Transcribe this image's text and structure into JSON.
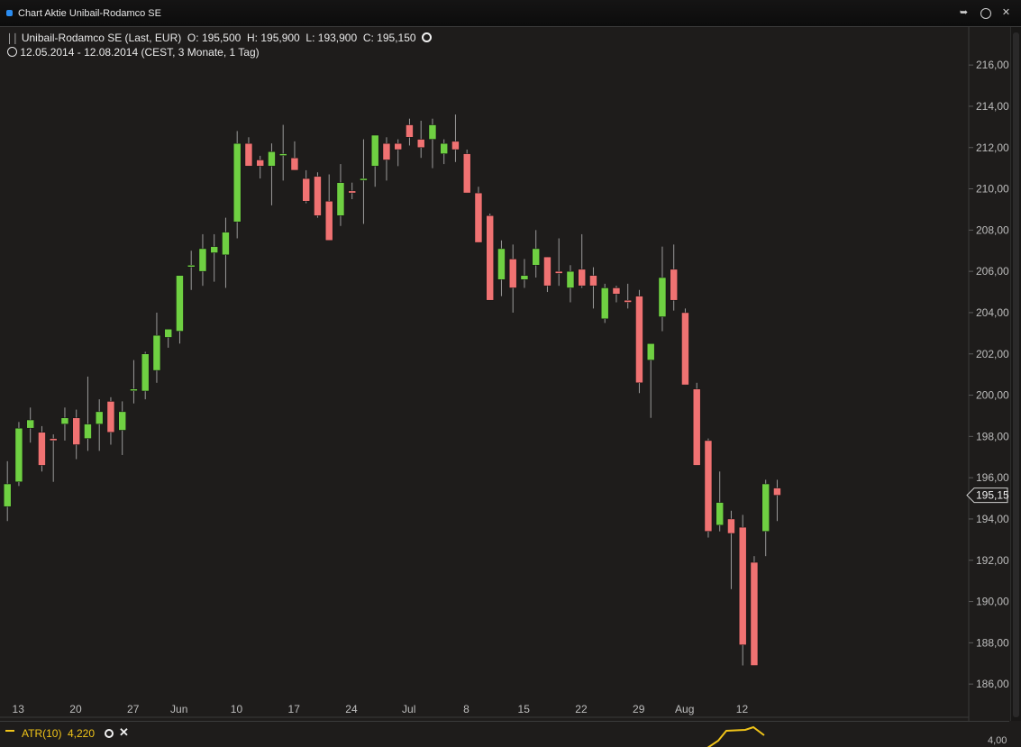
{
  "window": {
    "title": "Chart Aktie Unibail-Rodamco SE"
  },
  "header": {
    "instrument": "Unibail-Rodamco SE (Last, EUR)",
    "open_label": "O:",
    "open": "195,500",
    "high_label": "H:",
    "high": "195,900",
    "low_label": "L:",
    "low": "193,900",
    "close_label": "C:",
    "close": "195,150",
    "range": "12.05.2014 - 12.08.2014 (CEST, 3 Monate, 1 Tag)"
  },
  "price_marker": "195,150",
  "indicator": {
    "label": "ATR(10)",
    "value": "4,220",
    "axis_value": "4,00",
    "color": "#f0c419"
  },
  "colors": {
    "up": "#6fd042",
    "down": "#f07272",
    "wick": "#9a9a9a",
    "background": "#1e1c1b"
  },
  "chart_data": {
    "type": "candlestick",
    "title": "Unibail-Rodamco SE (Last, EUR)",
    "ylim": [
      185,
      216.5
    ],
    "y_ticks": [
      "186,000",
      "188,000",
      "190,000",
      "192,000",
      "194,000",
      "196,000",
      "198,000",
      "200,000",
      "202,000",
      "204,000",
      "206,000",
      "208,000",
      "210,000",
      "212,000",
      "214,000",
      "216,000"
    ],
    "y_tick_values": [
      186,
      188,
      190,
      192,
      194,
      196,
      198,
      200,
      202,
      204,
      206,
      208,
      210,
      212,
      214,
      216
    ],
    "x_ticks": [
      {
        "label": "13",
        "index": 0
      },
      {
        "label": "20",
        "index": 5
      },
      {
        "label": "27",
        "index": 10
      },
      {
        "label": "Jun",
        "index": 14
      },
      {
        "label": "10",
        "index": 19
      },
      {
        "label": "17",
        "index": 24
      },
      {
        "label": "24",
        "index": 29
      },
      {
        "label": "Jul",
        "index": 34
      },
      {
        "label": "8",
        "index": 39
      },
      {
        "label": "15",
        "index": 44
      },
      {
        "label": "22",
        "index": 49
      },
      {
        "label": "29",
        "index": 54
      },
      {
        "label": "Aug",
        "index": 58
      },
      {
        "label": "12",
        "index": 63
      }
    ],
    "candles": [
      {
        "o": 194.6,
        "h": 196.8,
        "l": 193.9,
        "c": 195.7
      },
      {
        "o": 195.8,
        "h": 198.7,
        "l": 195.6,
        "c": 198.4
      },
      {
        "o": 198.4,
        "h": 199.4,
        "l": 197.7,
        "c": 198.8
      },
      {
        "o": 198.2,
        "h": 198.5,
        "l": 196.3,
        "c": 196.6
      },
      {
        "o": 197.9,
        "h": 198.1,
        "l": 195.8,
        "c": 197.8
      },
      {
        "o": 198.6,
        "h": 199.4,
        "l": 197.8,
        "c": 198.9
      },
      {
        "o": 198.9,
        "h": 199.3,
        "l": 196.9,
        "c": 197.6
      },
      {
        "o": 197.9,
        "h": 200.9,
        "l": 197.3,
        "c": 198.6
      },
      {
        "o": 198.6,
        "h": 199.8,
        "l": 197.3,
        "c": 199.2
      },
      {
        "o": 199.7,
        "h": 199.9,
        "l": 197.6,
        "c": 198.2
      },
      {
        "o": 198.3,
        "h": 199.7,
        "l": 197.1,
        "c": 199.2
      },
      {
        "o": 200.3,
        "h": 201.7,
        "l": 199.6,
        "c": 200.3
      },
      {
        "o": 200.2,
        "h": 202.1,
        "l": 199.8,
        "c": 202.0
      },
      {
        "o": 201.2,
        "h": 204.0,
        "l": 200.6,
        "c": 202.9
      },
      {
        "o": 202.8,
        "h": 203.1,
        "l": 202.3,
        "c": 203.2
      },
      {
        "o": 203.1,
        "h": 205.8,
        "l": 202.5,
        "c": 205.8
      },
      {
        "o": 206.3,
        "h": 207.0,
        "l": 205.1,
        "c": 206.3
      },
      {
        "o": 206.0,
        "h": 207.8,
        "l": 205.3,
        "c": 207.1
      },
      {
        "o": 206.9,
        "h": 207.8,
        "l": 205.5,
        "c": 207.2
      },
      {
        "o": 206.8,
        "h": 208.6,
        "l": 205.2,
        "c": 207.9
      },
      {
        "o": 208.4,
        "h": 212.8,
        "l": 207.6,
        "c": 212.2
      },
      {
        "o": 212.2,
        "h": 212.5,
        "l": 211.2,
        "c": 211.1
      },
      {
        "o": 211.4,
        "h": 211.6,
        "l": 210.5,
        "c": 211.1
      },
      {
        "o": 211.1,
        "h": 212.2,
        "l": 209.2,
        "c": 211.8
      },
      {
        "o": 211.7,
        "h": 213.1,
        "l": 210.4,
        "c": 211.7
      },
      {
        "o": 211.5,
        "h": 212.3,
        "l": 210.9,
        "c": 210.9
      },
      {
        "o": 210.5,
        "h": 210.9,
        "l": 209.3,
        "c": 209.4
      },
      {
        "o": 210.6,
        "h": 210.8,
        "l": 208.6,
        "c": 208.7
      },
      {
        "o": 209.4,
        "h": 210.7,
        "l": 207.5,
        "c": 207.5
      },
      {
        "o": 208.7,
        "h": 211.2,
        "l": 208.2,
        "c": 210.3
      },
      {
        "o": 209.9,
        "h": 210.3,
        "l": 209.5,
        "c": 209.8
      },
      {
        "o": 210.5,
        "h": 212.4,
        "l": 208.3,
        "c": 210.5
      },
      {
        "o": 211.1,
        "h": 212.6,
        "l": 210.1,
        "c": 212.6
      },
      {
        "o": 212.2,
        "h": 212.5,
        "l": 210.4,
        "c": 211.4
      },
      {
        "o": 212.2,
        "h": 212.4,
        "l": 211.1,
        "c": 211.9
      },
      {
        "o": 213.1,
        "h": 213.4,
        "l": 212.1,
        "c": 212.5
      },
      {
        "o": 212.4,
        "h": 213.3,
        "l": 211.5,
        "c": 212.0
      },
      {
        "o": 212.4,
        "h": 213.4,
        "l": 211.0,
        "c": 213.1
      },
      {
        "o": 211.7,
        "h": 212.4,
        "l": 211.2,
        "c": 212.2
      },
      {
        "o": 212.3,
        "h": 213.6,
        "l": 211.3,
        "c": 211.9
      },
      {
        "o": 211.7,
        "h": 211.9,
        "l": 209.8,
        "c": 209.8
      },
      {
        "o": 209.8,
        "h": 210.1,
        "l": 207.4,
        "c": 207.4
      },
      {
        "o": 208.7,
        "h": 208.8,
        "l": 204.6,
        "c": 204.6
      },
      {
        "o": 205.6,
        "h": 207.5,
        "l": 204.8,
        "c": 207.1
      },
      {
        "o": 206.6,
        "h": 207.3,
        "l": 204.0,
        "c": 205.2
      },
      {
        "o": 205.6,
        "h": 206.6,
        "l": 205.2,
        "c": 205.8
      },
      {
        "o": 206.3,
        "h": 208.0,
        "l": 205.7,
        "c": 207.1
      },
      {
        "o": 206.7,
        "h": 206.7,
        "l": 205.0,
        "c": 205.3
      },
      {
        "o": 206.0,
        "h": 207.6,
        "l": 205.3,
        "c": 205.9
      },
      {
        "o": 205.2,
        "h": 206.3,
        "l": 204.5,
        "c": 206.0
      },
      {
        "o": 206.1,
        "h": 207.8,
        "l": 205.2,
        "c": 205.3
      },
      {
        "o": 205.8,
        "h": 206.2,
        "l": 204.2,
        "c": 205.3
      },
      {
        "o": 203.7,
        "h": 205.4,
        "l": 203.5,
        "c": 205.2
      },
      {
        "o": 205.2,
        "h": 205.3,
        "l": 204.5,
        "c": 204.9
      },
      {
        "o": 204.6,
        "h": 205.4,
        "l": 204.2,
        "c": 204.5
      },
      {
        "o": 204.8,
        "h": 205.1,
        "l": 200.1,
        "c": 200.6
      },
      {
        "o": 201.7,
        "h": 202.4,
        "l": 198.9,
        "c": 202.5
      },
      {
        "o": 203.8,
        "h": 207.2,
        "l": 203.1,
        "c": 205.7
      },
      {
        "o": 206.1,
        "h": 207.3,
        "l": 204.1,
        "c": 204.6
      },
      {
        "o": 204.0,
        "h": 204.2,
        "l": 200.5,
        "c": 200.5
      },
      {
        "o": 200.3,
        "h": 200.6,
        "l": 196.6,
        "c": 196.6
      },
      {
        "o": 197.8,
        "h": 197.9,
        "l": 193.1,
        "c": 193.4
      },
      {
        "o": 193.7,
        "h": 196.3,
        "l": 193.4,
        "c": 194.8
      },
      {
        "o": 194.0,
        "h": 194.4,
        "l": 190.6,
        "c": 193.3
      },
      {
        "o": 193.6,
        "h": 194.2,
        "l": 186.9,
        "c": 187.9
      },
      {
        "o": 191.9,
        "h": 192.2,
        "l": 186.9,
        "c": 186.9
      },
      {
        "o": 193.4,
        "h": 195.9,
        "l": 192.2,
        "c": 195.7
      },
      {
        "o": 195.5,
        "h": 195.9,
        "l": 193.9,
        "c": 195.15
      }
    ]
  }
}
